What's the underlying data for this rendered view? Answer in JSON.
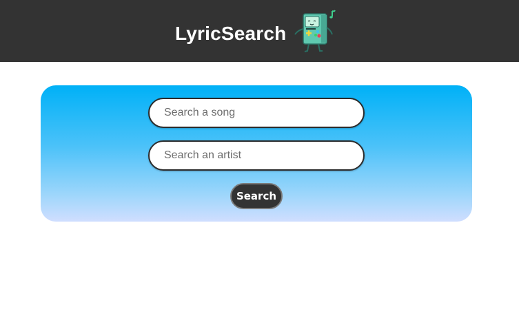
{
  "header": {
    "title": "LyricSearch",
    "mascot_icon": "bmo-robot-icon"
  },
  "search": {
    "song_placeholder": "Search a song",
    "song_value": "",
    "artist_placeholder": "Search an artist",
    "artist_value": "",
    "button_label": "Search"
  },
  "colors": {
    "header_bg": "#333333",
    "panel_gradient_top": "#00b1f7",
    "panel_gradient_bottom": "#d0deff",
    "button_bg": "#333333"
  }
}
